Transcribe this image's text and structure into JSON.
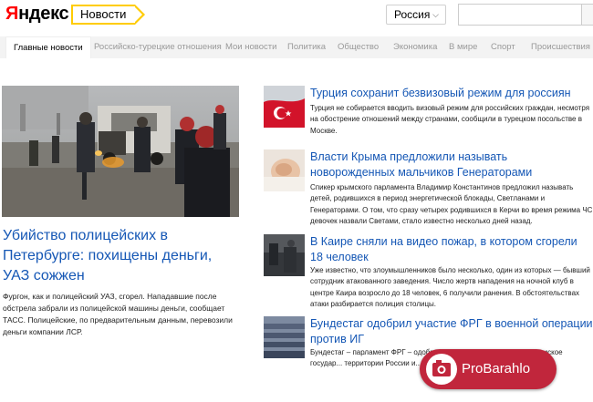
{
  "header": {
    "logo_first_letter": "Я",
    "logo_rest": "ндекс",
    "section": "Новости",
    "region": "Россия",
    "search_placeholder": ""
  },
  "nav": {
    "tabs": [
      {
        "label": "Главные новости",
        "active": true
      },
      {
        "label": "Российско-турецкие отношения",
        "active": false
      },
      {
        "label": "Мои новости",
        "active": false
      },
      {
        "label": "Политика",
        "active": false
      },
      {
        "label": "Общество",
        "active": false
      },
      {
        "label": "Экономика",
        "active": false
      },
      {
        "label": "В мире",
        "active": false
      },
      {
        "label": "Спорт",
        "active": false
      },
      {
        "label": "Происшествия",
        "active": false
      }
    ]
  },
  "main_story": {
    "title": "Убийство полицейских в Петербурге: похищены деньги, УАЗ сожжен",
    "snippet": "Фургон, как и полицейский УАЗ, сгорел. Нападавшие после обстрела забрали из полицейской машины деньги, сообщает ТАСС. Полицейские, по предварительным данным, перевозили деньги компании ЛСР."
  },
  "stories": [
    {
      "title": "Турция сохранит безвизовый режим для россиян",
      "text": "Турция не собирается вводить визовый режим для российских граждан, несмотря на обострение отношений между странами, сообщили в турецком посольстве в Москве."
    },
    {
      "title": "Власти Крыма предложили называть новорожденных мальчиков Генераторами",
      "text": "Спикер крымского парламента Владимир Константинов предложил называть детей, родившихся в период энергетической блокады, Светланами и Генераторами. О том, что сразу четырех родившихся в Керчи во время режима ЧС девочек назвали Светами, стало известно несколько дней назад."
    },
    {
      "title": "В Каире сняли на видео пожар, в котором сгорели 18 человек",
      "text": "Уже известно, что злоумышленников было несколько, один из которых — бывший сотрудник атакованного заведения. Число жертв нападения на ночной клуб в центре Каира возросло до 18 человек, 6 получили ранения. В обстоятельствах атаки разбирается полиция столицы."
    },
    {
      "title": "Бундестаг одобрил участие ФРГ в военной операции против ИГ",
      "text": "Бундестаг – парламент ФРГ – одобрил присоединиться к во... \"Исламское государ... территории России и... декабря сообщает Р..."
    }
  ],
  "watermark": {
    "text": "ProBarahlo"
  },
  "colors": {
    "link": "#1557b5",
    "logo_accent": "#ff0000",
    "section_border": "#ffcc00",
    "badge": "#c1263c"
  }
}
